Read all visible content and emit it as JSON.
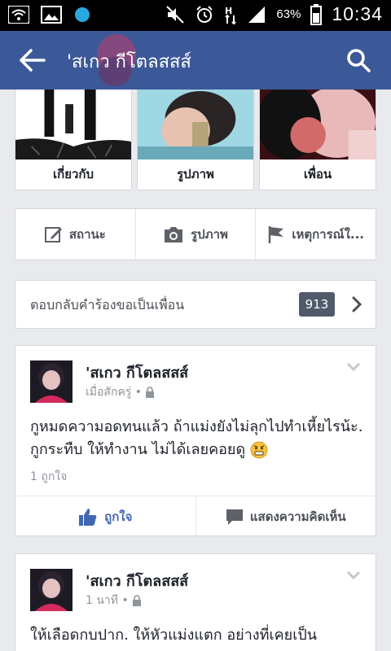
{
  "status_bar": {
    "battery_percent": "63%",
    "time": "10:34",
    "icons": [
      "wifi-icon",
      "image-icon",
      "circle-notification-icon",
      "mute-icon",
      "alarm-icon",
      "data-arrows-icon",
      "signal-icon",
      "battery-icon"
    ]
  },
  "header": {
    "title": "'สเกว กีโตลสสส์",
    "back_icon": "back-arrow-icon",
    "search_icon": "search-icon"
  },
  "tiles": [
    {
      "label": "เกี่ยวกับ"
    },
    {
      "label": "รูปภาพ"
    },
    {
      "label": "เพื่อน"
    }
  ],
  "actions": [
    {
      "label": "สถานะ",
      "icon": "edit-icon"
    },
    {
      "label": "รูปภาพ",
      "icon": "camera-icon"
    },
    {
      "label": "เหตุการณ์ใ...",
      "icon": "flag-icon"
    }
  ],
  "friend_requests": {
    "label": "ตอบกลับคำร้องขอเป็นเพื่อน",
    "count": "913"
  },
  "posts": [
    {
      "author": "'สเกว กีโตลสสส์",
      "time": "เมื่อสักครู่ •",
      "text": "กูหมดความอดทนแล้ว ถ้าแม่งยังไม่ลุกไปทำเหี้ยไรน้ะ. กูกระทืบ ให้ทำงาน ไม่ได้เลยคอยดู",
      "likes": "1 ถูกใจ",
      "like_label": "ถูกใจ",
      "comment_label": "แสดงความคิดเห็น"
    },
    {
      "author": "'สเกว กีโตลสสส์",
      "time": "1 นาที •",
      "text": "ให้เลือดกบปาก. ให้หัวแม่งแตก อย่างที่เคยเป็น"
    }
  ],
  "colors": {
    "brand": "#3b5998",
    "like": "#4267b2",
    "background": "#e9eaee"
  }
}
